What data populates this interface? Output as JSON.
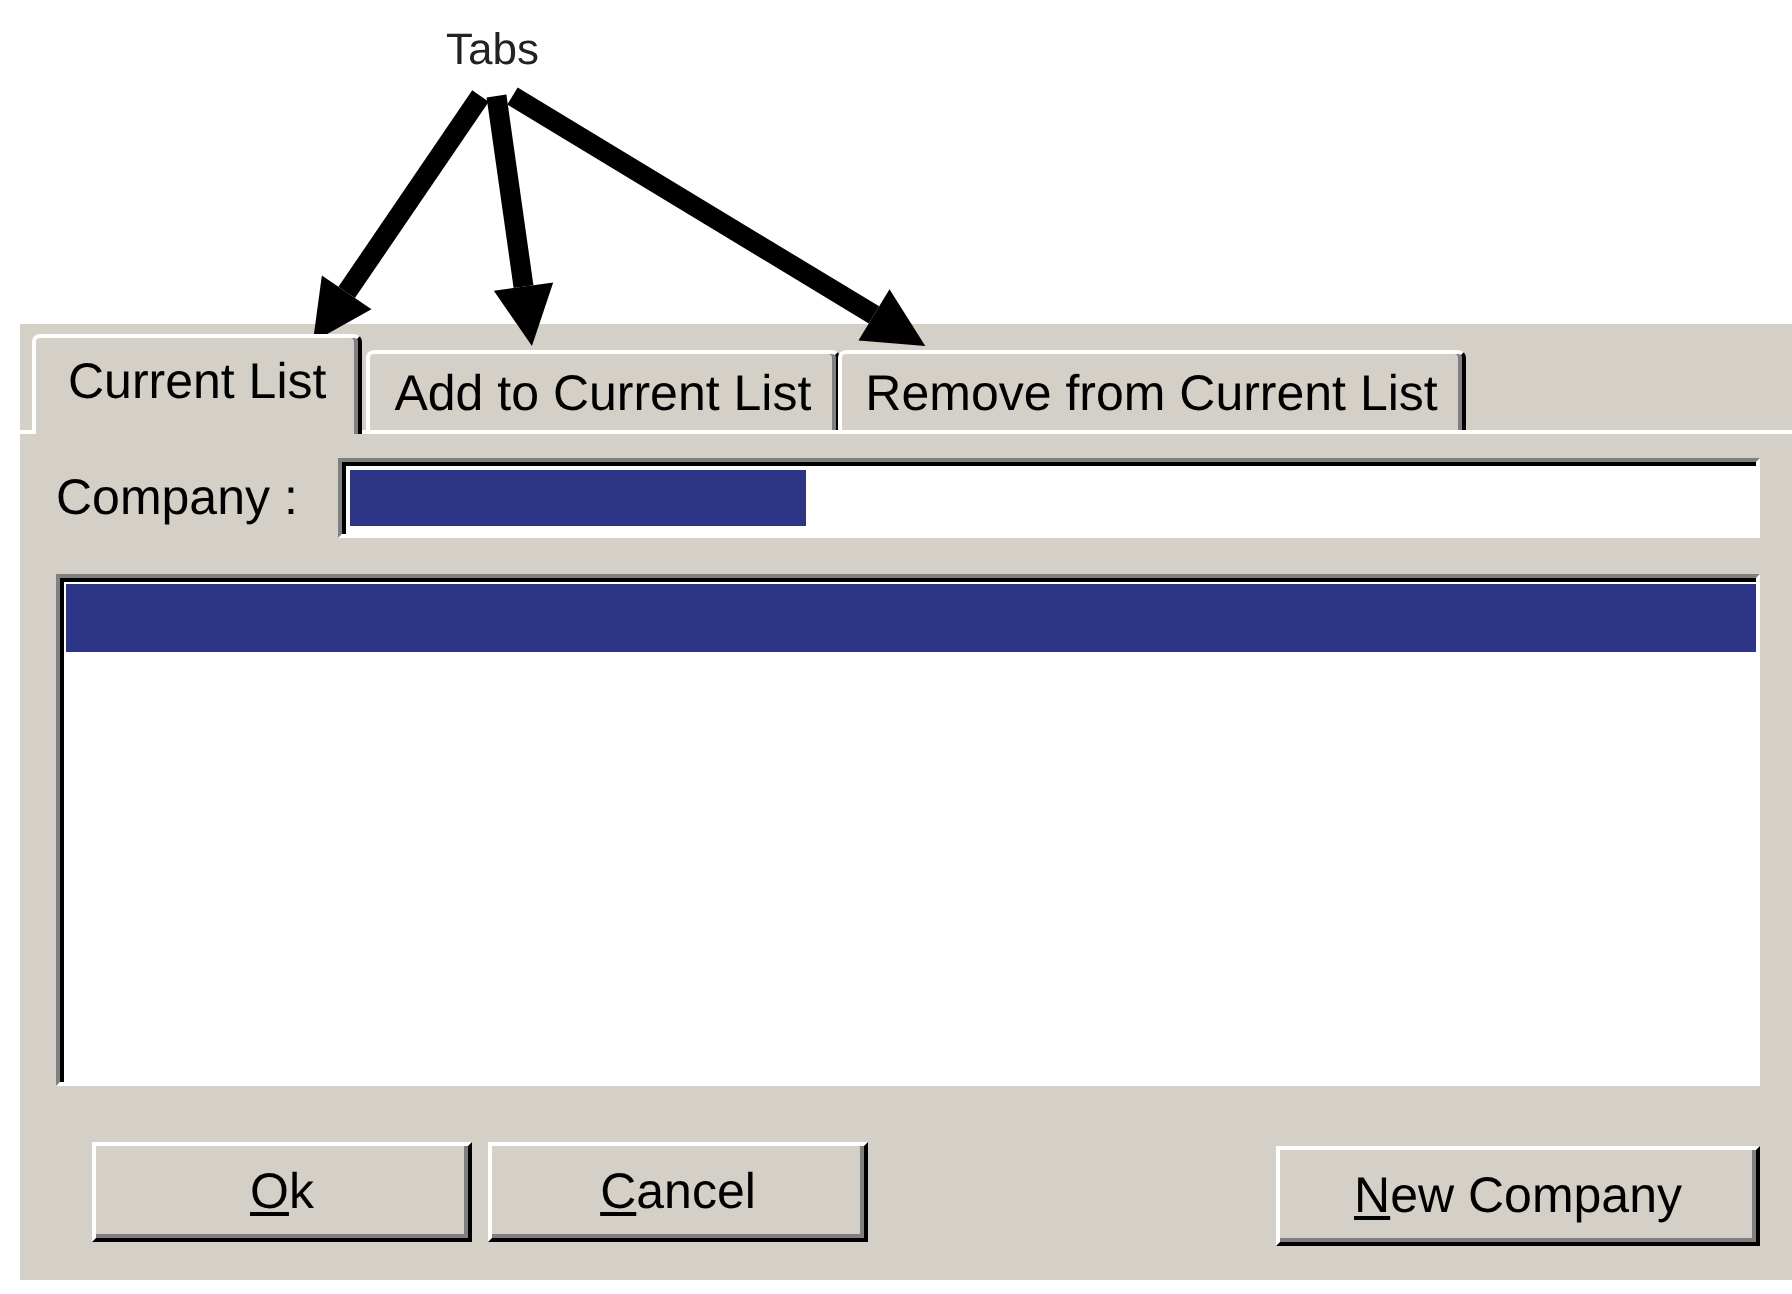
{
  "annotation": {
    "label": "Tabs"
  },
  "tabs": [
    {
      "label": "Current List",
      "selected": true,
      "annotated": true
    },
    {
      "label": "Add to Current List",
      "selected": false,
      "annotated": true
    },
    {
      "label": "Remove from Current List",
      "selected": false,
      "annotated": true
    }
  ],
  "company": {
    "label": "Company :",
    "text_selected": true
  },
  "list": {
    "rows": [
      {
        "selected": true
      }
    ]
  },
  "buttons_left": [
    {
      "label": "Ok",
      "mnemonic": true
    },
    {
      "label": "Cancel",
      "mnemonic": true
    }
  ],
  "buttons_right": [
    {
      "label": "New Company",
      "mnemonic": true
    }
  ]
}
